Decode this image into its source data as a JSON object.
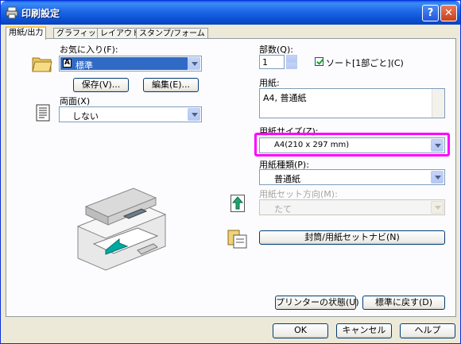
{
  "window": {
    "title": "印刷設定",
    "help_glyph": "?",
    "close_glyph": "✕"
  },
  "tabs": [
    {
      "label": "用紙/出力",
      "active": true
    },
    {
      "label": "グラフィックス"
    },
    {
      "label": "レイアウト"
    },
    {
      "label": "スタンプ/フォーム"
    }
  ],
  "favorites": {
    "label": "お気に入り(F):",
    "value": "標準",
    "value_icon": "A",
    "save_button": "保存(V)...",
    "edit_button": "編集(E)..."
  },
  "duplex": {
    "label": "両面(X)",
    "value": "しない"
  },
  "copies": {
    "label": "部数(Q):",
    "value": "1",
    "collate_label": "ソート[1部ごと](C)",
    "collate_checked": true
  },
  "paper": {
    "label": "用紙:",
    "summary": "A4, 普通紙"
  },
  "paper_size": {
    "label": "用紙サイズ(Z):",
    "value": "A4(210 x 297 mm)",
    "highlight_color": "#FF00FF"
  },
  "paper_type": {
    "label": "用紙種類(P):",
    "value": "普通紙"
  },
  "feed_direction": {
    "label": "用紙セット方向(M):",
    "value": "たて",
    "disabled": true
  },
  "envelope_button": "封筒/用紙セットナビ(N)",
  "printer_status_button": "プリンターの状態(U)",
  "restore_defaults_button": "標準に戻す(D)",
  "footer": {
    "ok": "OK",
    "cancel": "キャンセル",
    "help": "ヘルプ"
  },
  "colors": {
    "title_bar": "#0A4FD0",
    "face": "#ECE9D8",
    "highlight": "#FF00FF"
  }
}
